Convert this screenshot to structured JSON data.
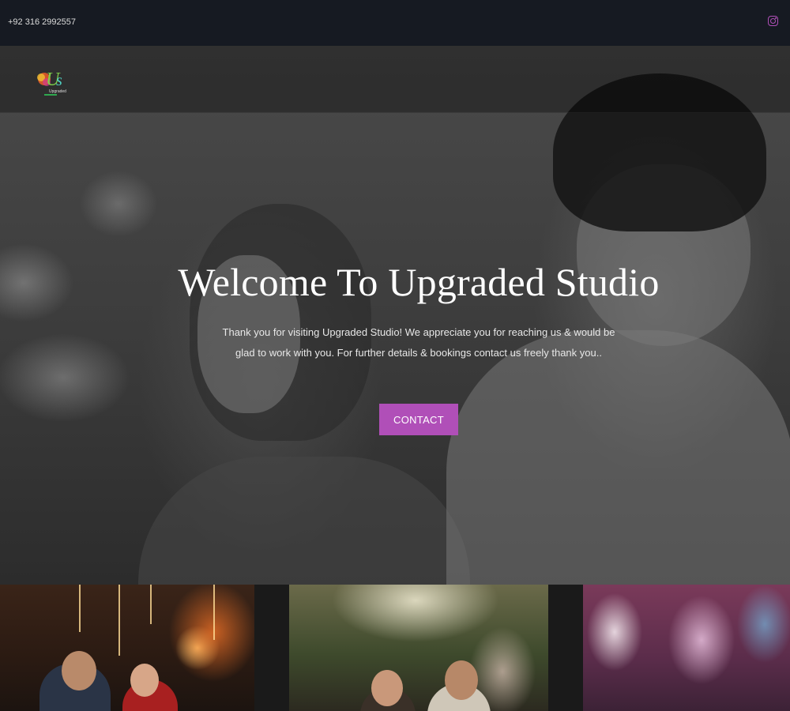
{
  "topbar": {
    "phone": "+92 316 2992557",
    "social_icon": "instagram-icon",
    "accent_color": "#b04fb8"
  },
  "brand": {
    "logo_icon": "upgraded-studio-logo",
    "logo_text": "Us",
    "logo_subtext": "Upgraded Studio"
  },
  "hero": {
    "title": "Welcome To Upgraded Studio",
    "description": "Thank you for visiting Upgraded Studio! We appreciate you for reaching us & would be glad to work with you. For further details & bookings contact us freely thank you..",
    "cta_label": "CONTACT"
  },
  "gallery": {
    "items": [
      "wedding-photo-1",
      "wedding-photo-2",
      "wedding-photo-3"
    ]
  }
}
